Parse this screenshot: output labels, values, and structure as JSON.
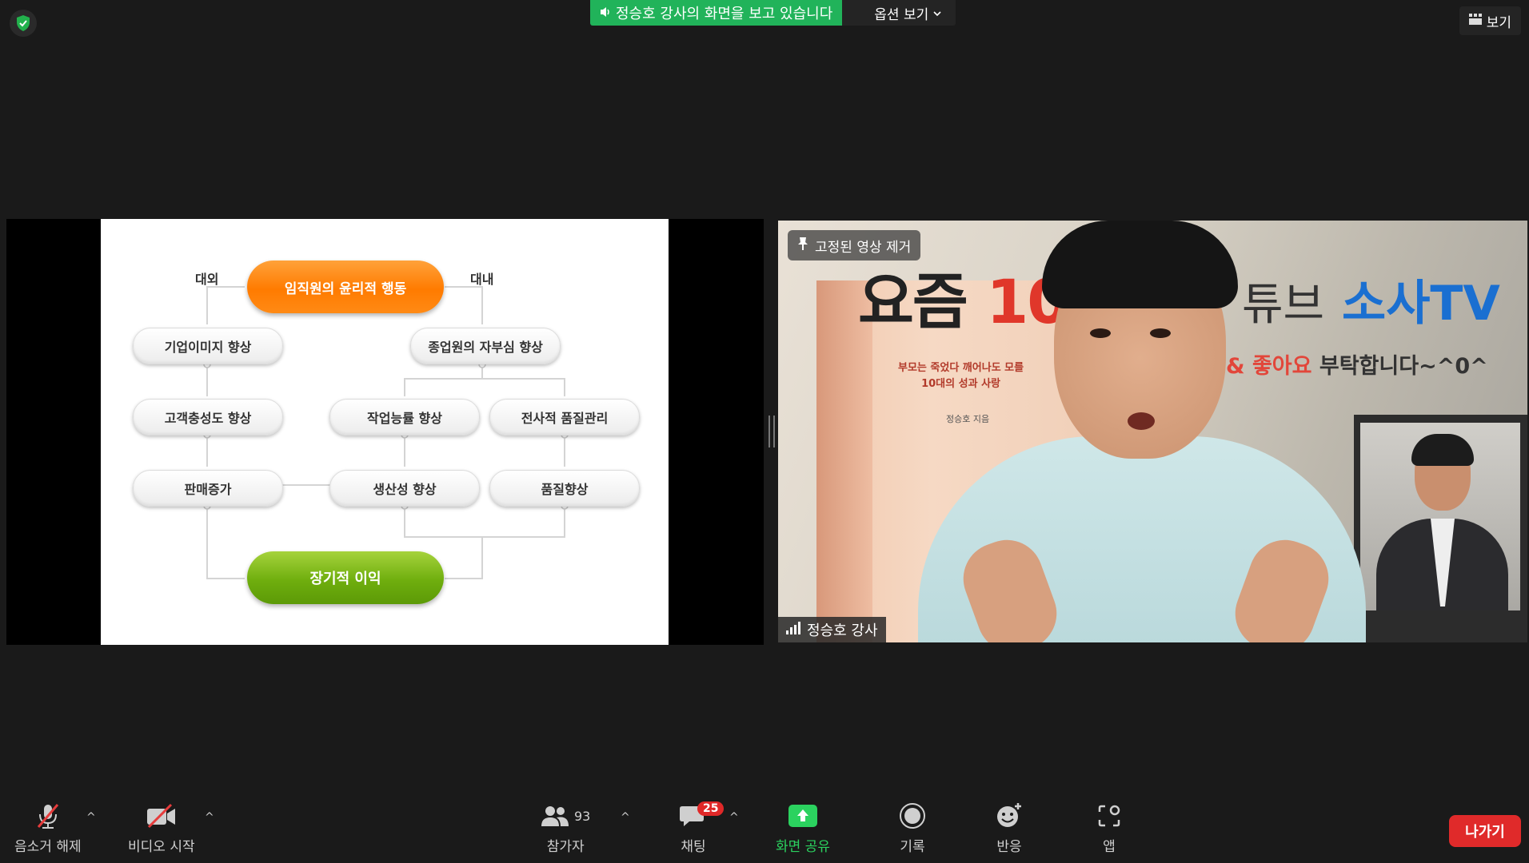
{
  "top": {
    "share_banner": "정승호 강사의 화면을 보고 있습니다",
    "options_label": "옵션 보기",
    "view_label": "보기"
  },
  "slide": {
    "top_label": "임직원의 윤리적 행동",
    "left_label": "대외",
    "right_label": "대내",
    "row1_left": "기업이미지 향상",
    "row1_right": "종업원의 자부심 향상",
    "row2_left": "고객충성도 향상",
    "row2_mid": "작업능률 향상",
    "row2_right": "전사적 품질관리",
    "row3_left": "판매증가",
    "row3_mid": "생산성 향상",
    "row3_right": "품질향상",
    "bottom_label": "장기적 이익"
  },
  "video": {
    "pin_label": "고정된 영상 제거",
    "participant_name": "정승호 강사",
    "book_title_black": "요즘 ",
    "book_title_red": "10대",
    "book_subtitle_1": "부모는 죽었다 깨어나도 모를",
    "book_subtitle_2": "10대의 성과 사랑",
    "book_author": "정승호 지음",
    "bg_text_youtube": "튜브",
    "bg_text_channel": "소사TV",
    "bg_text_like": "& 좋아요",
    "bg_text_request": " 부탁합니다~^0^"
  },
  "toolbar": {
    "mute_label": "음소거 해제",
    "video_label": "비디오 시작",
    "participants_label": "참가자",
    "participants_count": "93",
    "chat_label": "채팅",
    "chat_badge": "25",
    "share_label": "화면 공유",
    "record_label": "기록",
    "reaction_label": "반응",
    "apps_label": "앱",
    "leave_label": "나가기"
  },
  "colors": {
    "background": "#1a1a1a",
    "share_green": "#21b35a",
    "leave_red": "#e02a2a",
    "chat_badge_red": "#e02828",
    "share_icon_green": "#2bd25f"
  }
}
